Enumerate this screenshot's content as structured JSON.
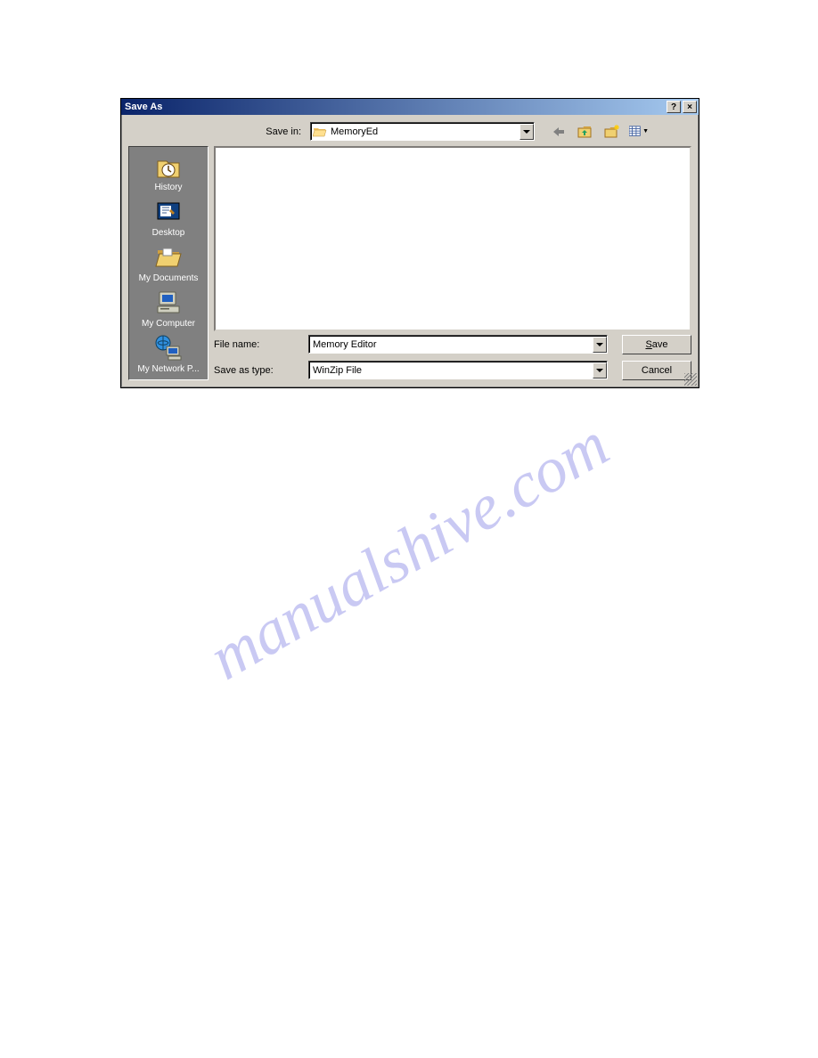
{
  "dialog": {
    "title": "Save As",
    "help_glyph": "?",
    "close_glyph": "×"
  },
  "save_in": {
    "label": "Save in:",
    "value": "MemoryEd"
  },
  "toolbar": {
    "back": "←",
    "up": "📁",
    "new": "✨",
    "views": "▦"
  },
  "places": [
    {
      "label": "History"
    },
    {
      "label": "Desktop"
    },
    {
      "label": "My Documents"
    },
    {
      "label": "My Computer"
    },
    {
      "label": "My Network P..."
    }
  ],
  "filename": {
    "label": "File name:",
    "value": "Memory Editor"
  },
  "filetype": {
    "label": "Save as type:",
    "value": "WinZip File"
  },
  "buttons": {
    "save": "Save",
    "cancel": "Cancel"
  },
  "watermark": "manualshive.com"
}
